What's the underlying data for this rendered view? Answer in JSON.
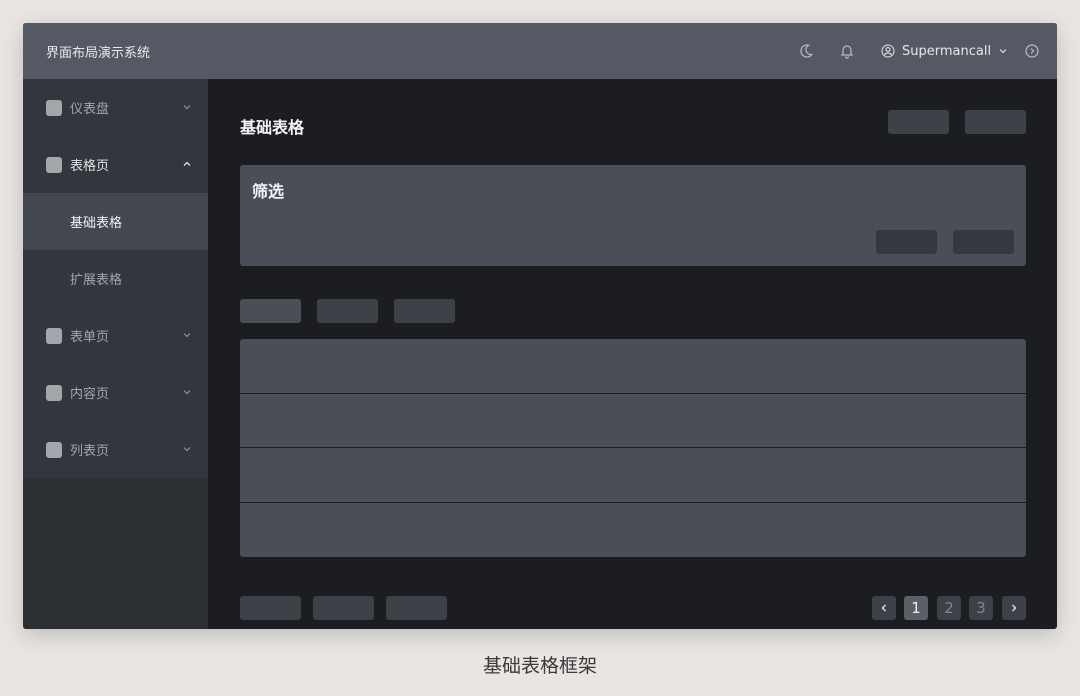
{
  "header": {
    "app_title": "界面布局演示系统",
    "user_name": "Supermancall",
    "icons": [
      "moon-icon",
      "bell-icon",
      "user-circle-icon",
      "chevron-down-icon",
      "power-icon"
    ]
  },
  "sidebar": {
    "items": [
      {
        "label": "仪表盘",
        "expanded": false
      },
      {
        "label": "表格页",
        "expanded": true,
        "children": [
          {
            "label": "基础表格",
            "active": true
          },
          {
            "label": "扩展表格",
            "active": false
          }
        ]
      },
      {
        "label": "表单页",
        "expanded": false
      },
      {
        "label": "内容页",
        "expanded": false
      },
      {
        "label": "列表页",
        "expanded": false
      }
    ]
  },
  "main": {
    "page_title": "基础表格",
    "filter": {
      "title": "筛选"
    },
    "table": {
      "row_count": 4
    },
    "pagination": {
      "pages": [
        "1",
        "2",
        "3"
      ],
      "current": "1",
      "prev": "‹",
      "next": "›"
    }
  },
  "caption": "基础表格框架",
  "colors": {
    "header_bg": "#555963",
    "sidebar_bg": "#2c2f34",
    "main_bg": "#1c1d21",
    "card_bg": "#4a4e57",
    "placeholder": "#3e4148",
    "active_page": "#5b5f68"
  }
}
